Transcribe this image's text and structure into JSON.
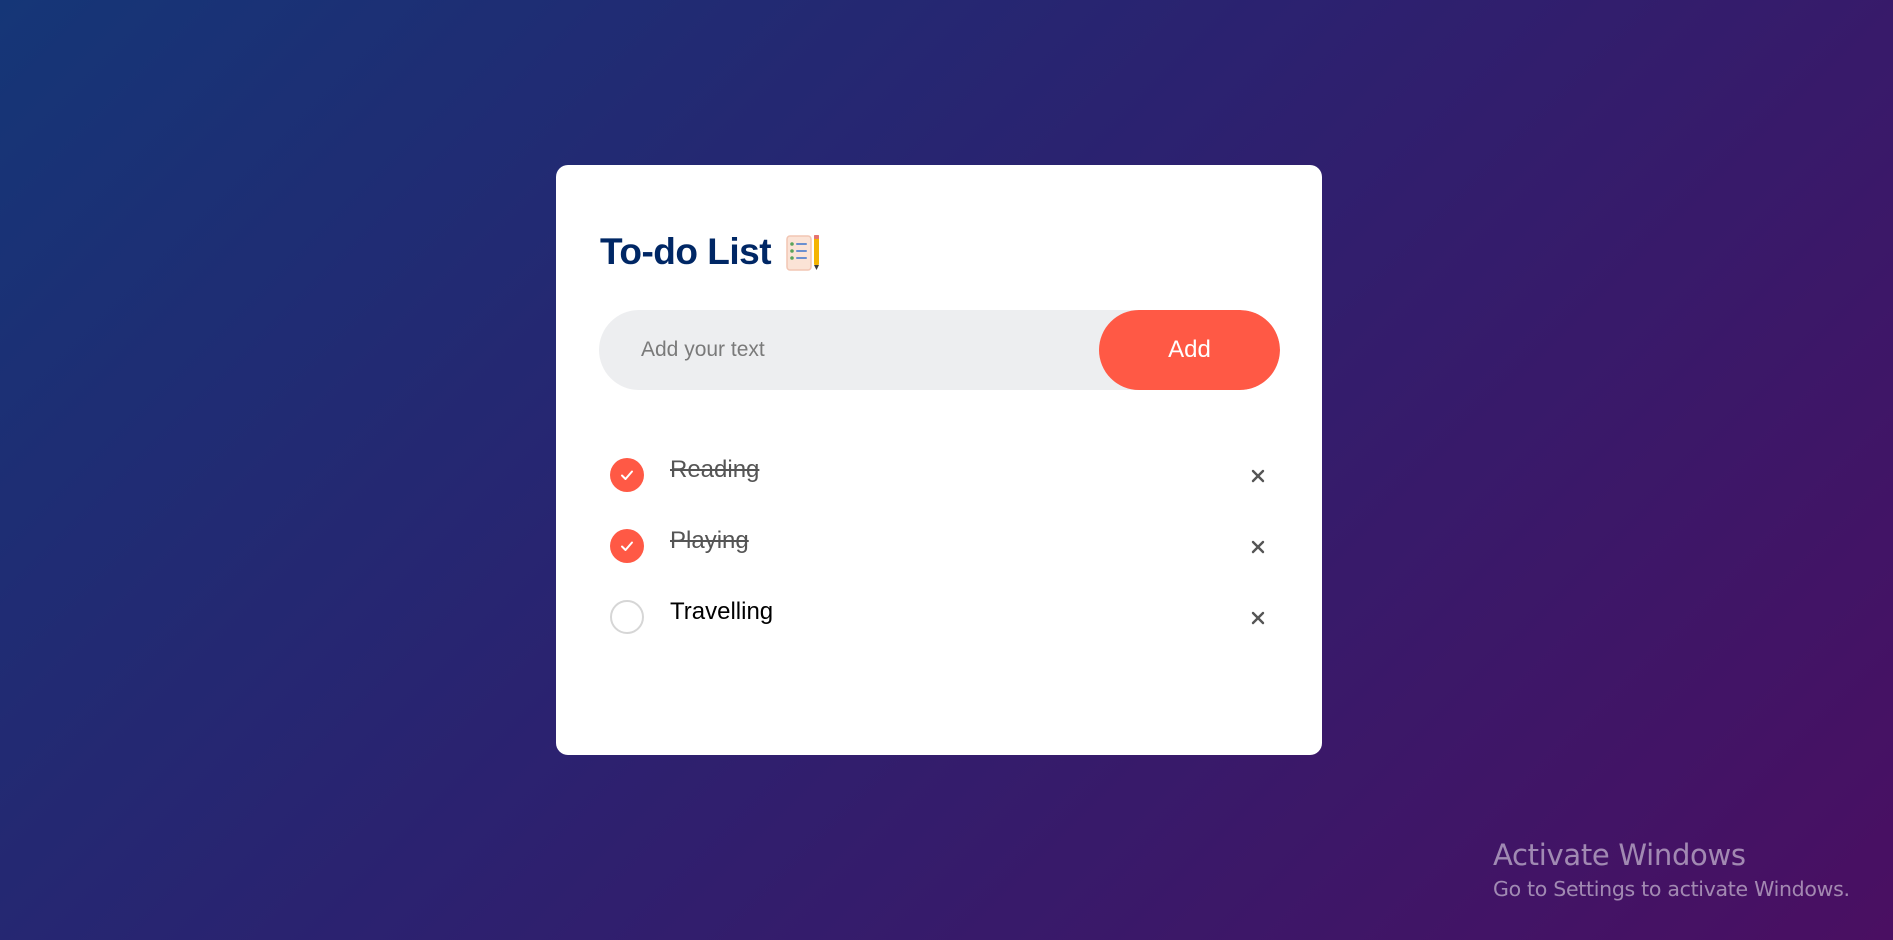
{
  "app": {
    "title": "To-do List",
    "title_icon": "notepad-icon",
    "accent_color": "#ff5945",
    "title_color": "#002765"
  },
  "input": {
    "placeholder": "Add your text",
    "value": ""
  },
  "add_button": {
    "label": "Add"
  },
  "tasks": [
    {
      "label": "Reading",
      "checked": true,
      "delete_icon": "close-icon"
    },
    {
      "label": "Playing",
      "checked": true,
      "delete_icon": "close-icon"
    },
    {
      "label": "Travelling",
      "checked": false,
      "delete_icon": "close-icon"
    }
  ],
  "watermark": {
    "title": "Activate Windows",
    "subtitle": "Go to Settings to activate Windows."
  }
}
